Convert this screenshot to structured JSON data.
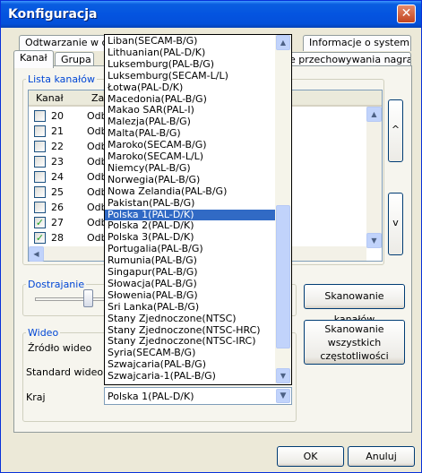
{
  "window": {
    "title": "Konfiguracja"
  },
  "tabs_back": [
    {
      "label": "Odtwarzanie w cza"
    },
    {
      "label": "Informacje o systemie"
    }
  ],
  "tabs_front": [
    {
      "label": "Kanał"
    },
    {
      "label": "Grupa"
    },
    {
      "label": "e przechowywania nagrania"
    }
  ],
  "channels": {
    "group_label": "Lista kanałów",
    "columns": [
      "Kanał",
      "Zab"
    ],
    "rows": [
      {
        "num": "20",
        "text": "Odb",
        "checked": ""
      },
      {
        "num": "21",
        "text": "Odb",
        "checked": ""
      },
      {
        "num": "22",
        "text": "Odb",
        "checked": ""
      },
      {
        "num": "23",
        "text": "Odb",
        "checked": ""
      },
      {
        "num": "24",
        "text": "Odb",
        "checked": ""
      },
      {
        "num": "25",
        "text": "Odb",
        "checked": ""
      },
      {
        "num": "26",
        "text": "Odb",
        "checked": ""
      },
      {
        "num": "27",
        "text": "Odb",
        "checked": "✓"
      },
      {
        "num": "28",
        "text": "Odb",
        "checked": "✓"
      }
    ],
    "up_label": "^",
    "down_label": "v"
  },
  "tuning": {
    "group_label": "Dostrajanie",
    "scan_channels": "Skanowanie kanałów",
    "scan_all": "Skanowanie wszystkich częstotliwości"
  },
  "video": {
    "group_label": "Wideo",
    "source_label": "Źródło wideo",
    "standard_label": "Standard wideo",
    "country_label": "Kraj",
    "country_value": "Polska 1(PAL-D/K)"
  },
  "dropdown_items": [
    "Liban(SECAM-B/G)",
    "Lithuanian(PAL-D/K)",
    "Luksemburg(PAL-B/G)",
    "Luksemburg(SECAM-L/L)",
    "Łotwa(PAL-D/K)",
    "Macedonia(PAL-B/G)",
    "Makao SAR(PAL-I)",
    "Malezja(PAL-B/G)",
    "Malta(PAL-B/G)",
    "Maroko(SECAM-B/G)",
    "Maroko(SECAM-L/L)",
    "Niemcy(PAL-B/G)",
    "Norwegia(PAL-B/G)",
    "Nowa Zelandia(PAL-B/G)",
    "Pakistan(PAL-B/G)",
    "Polska 1(PAL-D/K)",
    "Polska 2(PAL-D/K)",
    "Polska 3(PAL-D/K)",
    "Portugalia(PAL-B/G)",
    "Rumunia(PAL-B/G)",
    "Singapur(PAL-B/G)",
    "Słowacja(PAL-B/G)",
    "Słowenia(PAL-B/G)",
    "Sri Lanka(PAL-B/G)",
    "Stany Zjednoczone(NTSC)",
    "Stany Zjednoczone(NTSC-HRC)",
    "Stany Zjednoczone(NTSC-IRC)",
    "Syria(SECAM-B/G)",
    "Szwajcaria(PAL-B/G)",
    "Szwajcaria-1(PAL-B/G)"
  ],
  "dropdown_selected_index": 15,
  "footer": {
    "ok": "OK",
    "cancel": "Anuluj"
  },
  "colors": {
    "title_bar": "#0454e0",
    "selection": "#316ac5",
    "group_label": "#0046d5"
  }
}
